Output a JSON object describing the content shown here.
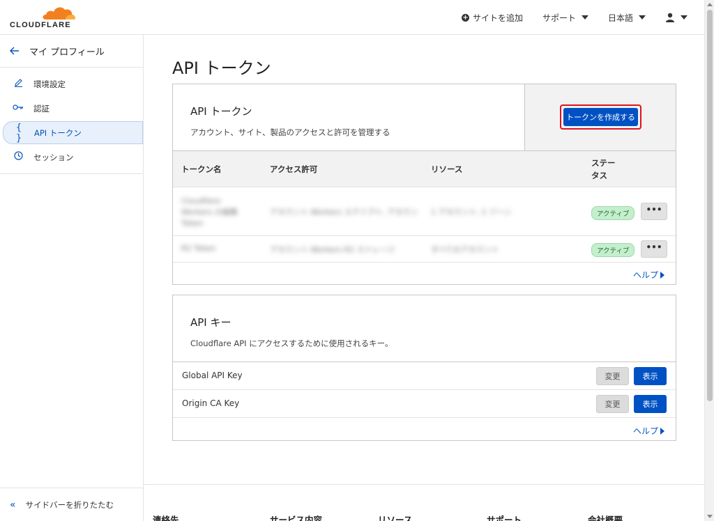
{
  "brand": {
    "name": "CLOUDFLARE",
    "accent": "#f38020",
    "primary": "#0051c3"
  },
  "topnav": {
    "add_site": "サイトを追加",
    "support": "サポート",
    "language": "日本語",
    "user_icon": "user-icon"
  },
  "sidebar": {
    "back_label": "マイ プロフィール",
    "items": [
      {
        "label": "環境設定",
        "icon": "pencil-icon"
      },
      {
        "label": "認証",
        "icon": "key-icon"
      },
      {
        "label": "API トークン",
        "icon": "braces-icon",
        "active": true
      },
      {
        "label": "セッション",
        "icon": "clock-icon"
      }
    ],
    "collapse_label": "サイドバーを折りたたむ"
  },
  "page": {
    "title": "API トークン"
  },
  "tokens_card": {
    "title": "API トークン",
    "description": "アカウント、サイト、製品のアクセスと許可を管理する",
    "create_button": "トークンを作成する",
    "columns": [
      "トークン名",
      "アクセス許可",
      "リソース",
      "ステータス"
    ],
    "rows": [
      {
        "name": "Cloudflare Workers の編集 Token",
        "permissions": "アカウント.Workers スクリプト, アカウント…",
        "resources": "1 アカウント, 1 ゾーン",
        "status": "アクティブ"
      },
      {
        "name": "R2 Token",
        "permissions": "アカウント.Workers R2 ストレージ",
        "resources": "すべてのアカウント",
        "status": "アクティブ"
      }
    ],
    "more_label": "•••",
    "help": "ヘルプ"
  },
  "keys_card": {
    "title": "API キー",
    "description": "Cloudflare API にアクセスするために使用されるキー。",
    "rows": [
      {
        "label": "Global API Key",
        "change": "変更",
        "view": "表示"
      },
      {
        "label": "Origin CA Key",
        "change": "変更",
        "view": "表示"
      }
    ],
    "help": "ヘルプ"
  },
  "footer": {
    "columns": [
      "連絡先",
      "サービス内容",
      "リソース",
      "サポート",
      "会社概要"
    ]
  }
}
